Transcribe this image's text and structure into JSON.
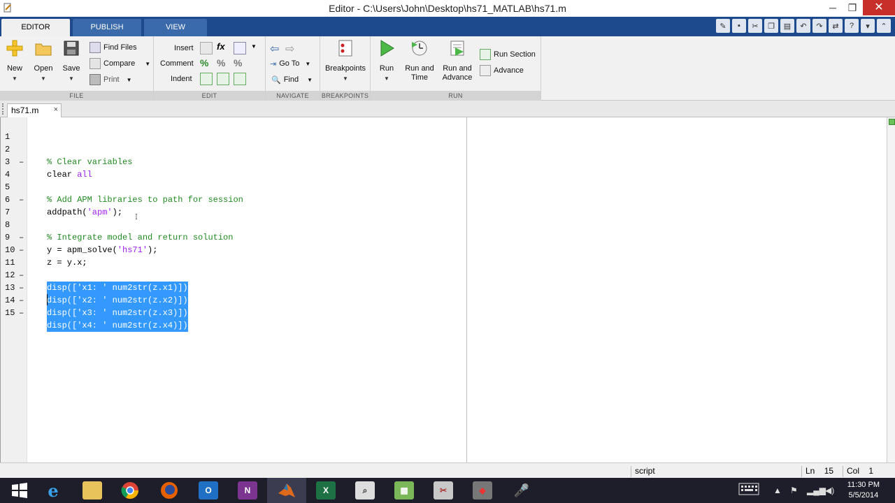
{
  "window": {
    "title": "Editor - C:\\Users\\John\\Desktop\\hs71_MATLAB\\hs71.m",
    "minimize": "─",
    "maximize": "❐",
    "close": "✕"
  },
  "ribbon_tabs": [
    "EDITOR",
    "PUBLISH",
    "VIEW"
  ],
  "ribbon": {
    "file": {
      "label": "FILE",
      "new": "New",
      "open": "Open",
      "save": "Save",
      "find_files": "Find Files",
      "compare": "Compare",
      "print": "Print"
    },
    "edit": {
      "label": "EDIT",
      "insert": "Insert",
      "comment": "Comment",
      "indent": "Indent",
      "fx": "fx"
    },
    "navigate": {
      "label": "NAVIGATE",
      "go_to": "Go To",
      "find": "Find"
    },
    "breakpoints": {
      "label": "BREAKPOINTS",
      "breakpoints": "Breakpoints"
    },
    "run": {
      "label": "RUN",
      "run": "Run",
      "run_and_time_1": "Run and",
      "run_and_time_2": "Time",
      "run_and_advance_1": "Run and",
      "run_and_advance_2": "Advance",
      "run_section": "Run Section",
      "advance": "Advance"
    }
  },
  "file_tab": {
    "name": "hs71.m",
    "close": "×"
  },
  "code_lines": [
    {
      "n": "1",
      "dash": "",
      "text": "% Clear variables"
    },
    {
      "n": "2",
      "dash": "–",
      "text": "clear all"
    },
    {
      "n": "3",
      "dash": "",
      "text": ""
    },
    {
      "n": "4",
      "dash": "",
      "text": "% Add APM libraries to path for session"
    },
    {
      "n": "5",
      "dash": "–",
      "text": "addpath('apm');"
    },
    {
      "n": "6",
      "dash": "",
      "text": ""
    },
    {
      "n": "7",
      "dash": "",
      "text": "% Integrate model and return solution"
    },
    {
      "n": "8",
      "dash": "–",
      "text": "y = apm_solve('hs71');"
    },
    {
      "n": "9",
      "dash": "–",
      "text": "z = y.x;"
    },
    {
      "n": "10",
      "dash": "",
      "text": ""
    },
    {
      "n": "11",
      "dash": "–",
      "text": "disp(['x1: ' num2str(z.x1)])"
    },
    {
      "n": "12",
      "dash": "–",
      "text": "disp(['x2: ' num2str(z.x2)])"
    },
    {
      "n": "13",
      "dash": "–",
      "text": "disp(['x3: ' num2str(z.x3)])"
    },
    {
      "n": "14",
      "dash": "–",
      "text": "disp(['x4: ' num2str(z.x4)])"
    },
    {
      "n": "15",
      "dash": "",
      "text": ""
    }
  ],
  "code_parts": {
    "l2_a": "clear ",
    "l2_b": "all",
    "l5_a": "addpath(",
    "l5_b": "'apm'",
    "l5_c": ");",
    "l8_a": "y = apm_solve(",
    "l8_b": "'hs71'",
    "l8_c": ");"
  },
  "status": {
    "mode": "script",
    "ln_label": "Ln",
    "ln": "15",
    "col_label": "Col",
    "col": "1"
  },
  "taskbar": {
    "time": "11:30 PM",
    "date": "5/5/2014",
    "apps": [
      "start",
      "internet-explorer",
      "file-explorer",
      "chrome",
      "firefox",
      "outlook",
      "onenote",
      "matlab",
      "excel",
      "app-search",
      "app-chart",
      "app-tools",
      "app-game",
      "app-mic"
    ]
  },
  "colors": {
    "ribbon_tab_bg": "#1c4a8c",
    "comment": "#228b22",
    "string": "#a020f0",
    "selection": "#3399ff",
    "close_button": "#c7302a"
  }
}
